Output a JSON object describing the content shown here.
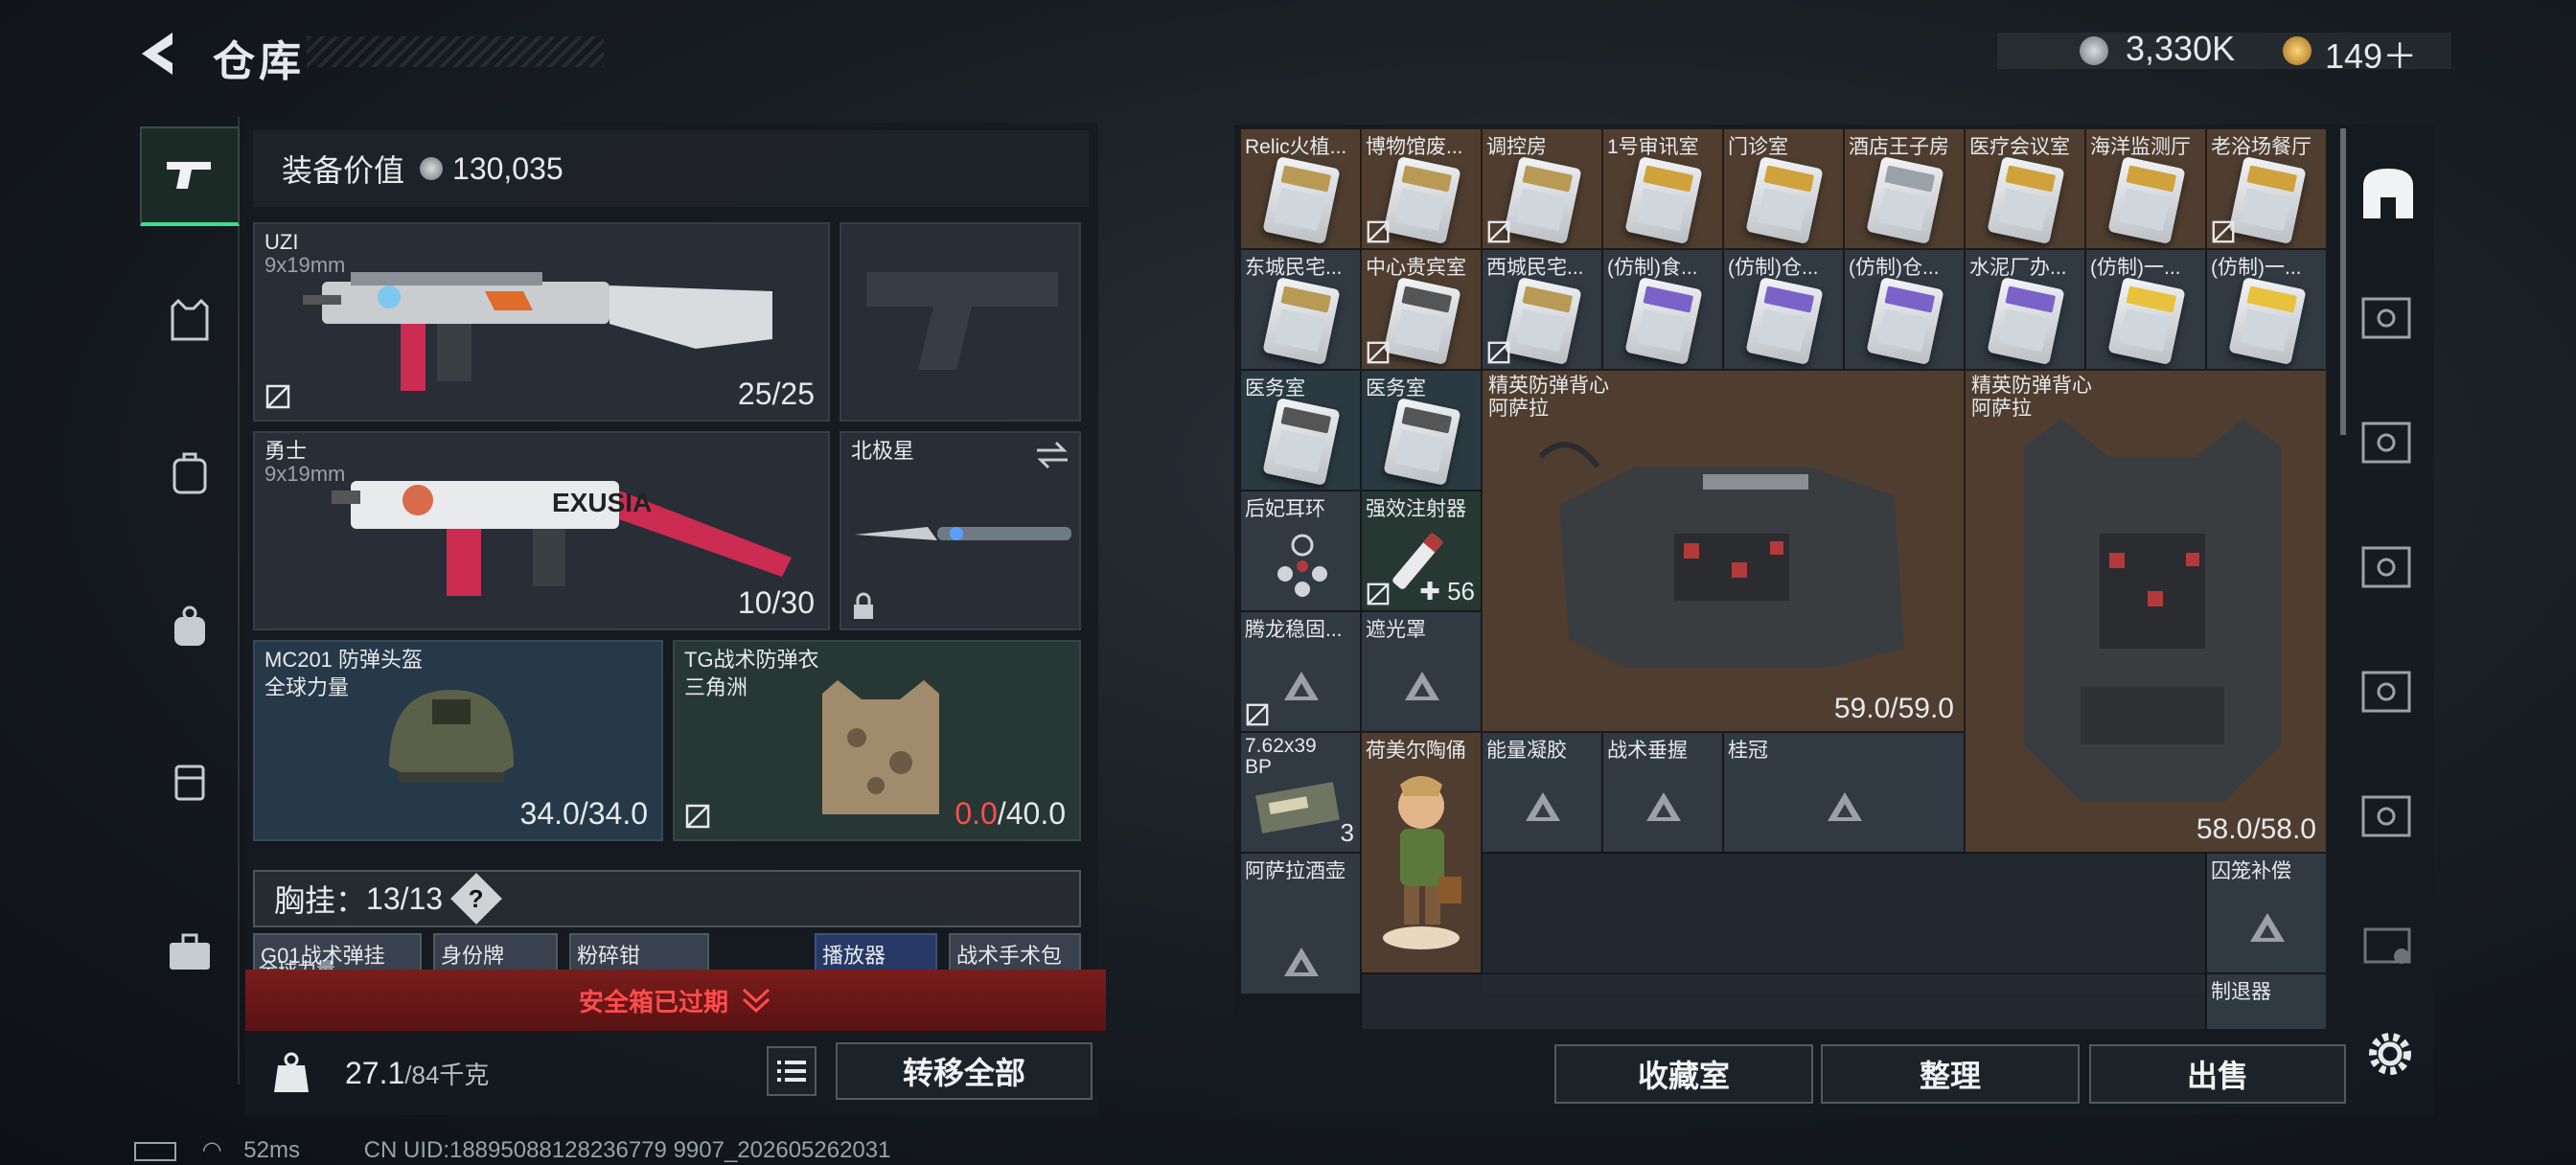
{
  "header": {
    "title": "仓库",
    "silver_amount": "3,330K",
    "gold_amount": "149＋"
  },
  "left_panel": {
    "equip_value_label": "装备价值",
    "equip_value": "130,035",
    "primary_weapon": {
      "name": "UZI",
      "ammo_type": "9x19mm",
      "ammo": "25/25"
    },
    "secondary_weapon": {
      "name": "勇士",
      "ammo_type": "9x19mm",
      "ammo": "10/30",
      "skin_text": "EXUSIA"
    },
    "melee": {
      "name": "北极星"
    },
    "helmet": {
      "name": "MC201 防弹头盔",
      "brand": "全球力量",
      "durability": "34.0/34.0"
    },
    "armor": {
      "name": "TG战术防弹衣",
      "brand": "三角洲",
      "durability_current": "0.0",
      "durability_max": "/40.0"
    },
    "chest_rig": {
      "label": "胸挂：",
      "count": "13/13",
      "help": "?"
    },
    "rig_items": [
      "G01战术弹挂",
      "全球力量",
      "身份牌",
      "粉碎钳",
      "播放器",
      "战术手术包"
    ],
    "safebox_banner": "安全箱已过期",
    "weight": {
      "current": "27.1",
      "max": "/84千克"
    },
    "transfer_all": "转移全部"
  },
  "grid": {
    "row1": [
      "Relic火植...",
      "博物馆废...",
      "调控房",
      "1号审讯室",
      "门诊室",
      "酒店王子房",
      "医疗会议室",
      "海洋监测厅",
      "老浴场餐厅"
    ],
    "row2": [
      "东城民宅...",
      "中心贵宾室",
      "西城民宅...",
      "(仿制)食...",
      "(仿制)仓...",
      "(仿制)仓...",
      "水泥厂办...",
      "(仿制)一...",
      "(仿制)一..."
    ],
    "medical1": "医务室",
    "medical2": "医务室",
    "earring": "后妃耳环",
    "injector": "强效注射器",
    "injector_count": "✚ 56",
    "stabilizer": "腾龙稳固...",
    "shade": "遮光罩",
    "ammo_name": "7.62x39",
    "ammo_sub": "BP",
    "ammo_count": "3",
    "figurine": "荷美尔陶俑",
    "gel": "能量凝胶",
    "grip": "战术垂握",
    "laurel": "桂冠",
    "liquor": "阿萨拉酒壶",
    "cage": "囚笼补偿",
    "retreat": "制退器",
    "vest1": {
      "name": "精英防弹背心",
      "brand": "阿萨拉",
      "durability": "59.0/59.0"
    },
    "vest2": {
      "name": "精英防弹背心",
      "brand": "阿萨拉",
      "durability": "58.0/58.0"
    }
  },
  "bottom_buttons": {
    "collection": "收藏室",
    "sort": "整理",
    "sell": "出售"
  },
  "status": {
    "ping": "52ms",
    "uid": "CN UID:18895088128236779 9907_202605262031"
  },
  "colors": {
    "accent": "#3ddc97",
    "warning": "#ff4d4d",
    "brown_cell": "#52402f"
  }
}
